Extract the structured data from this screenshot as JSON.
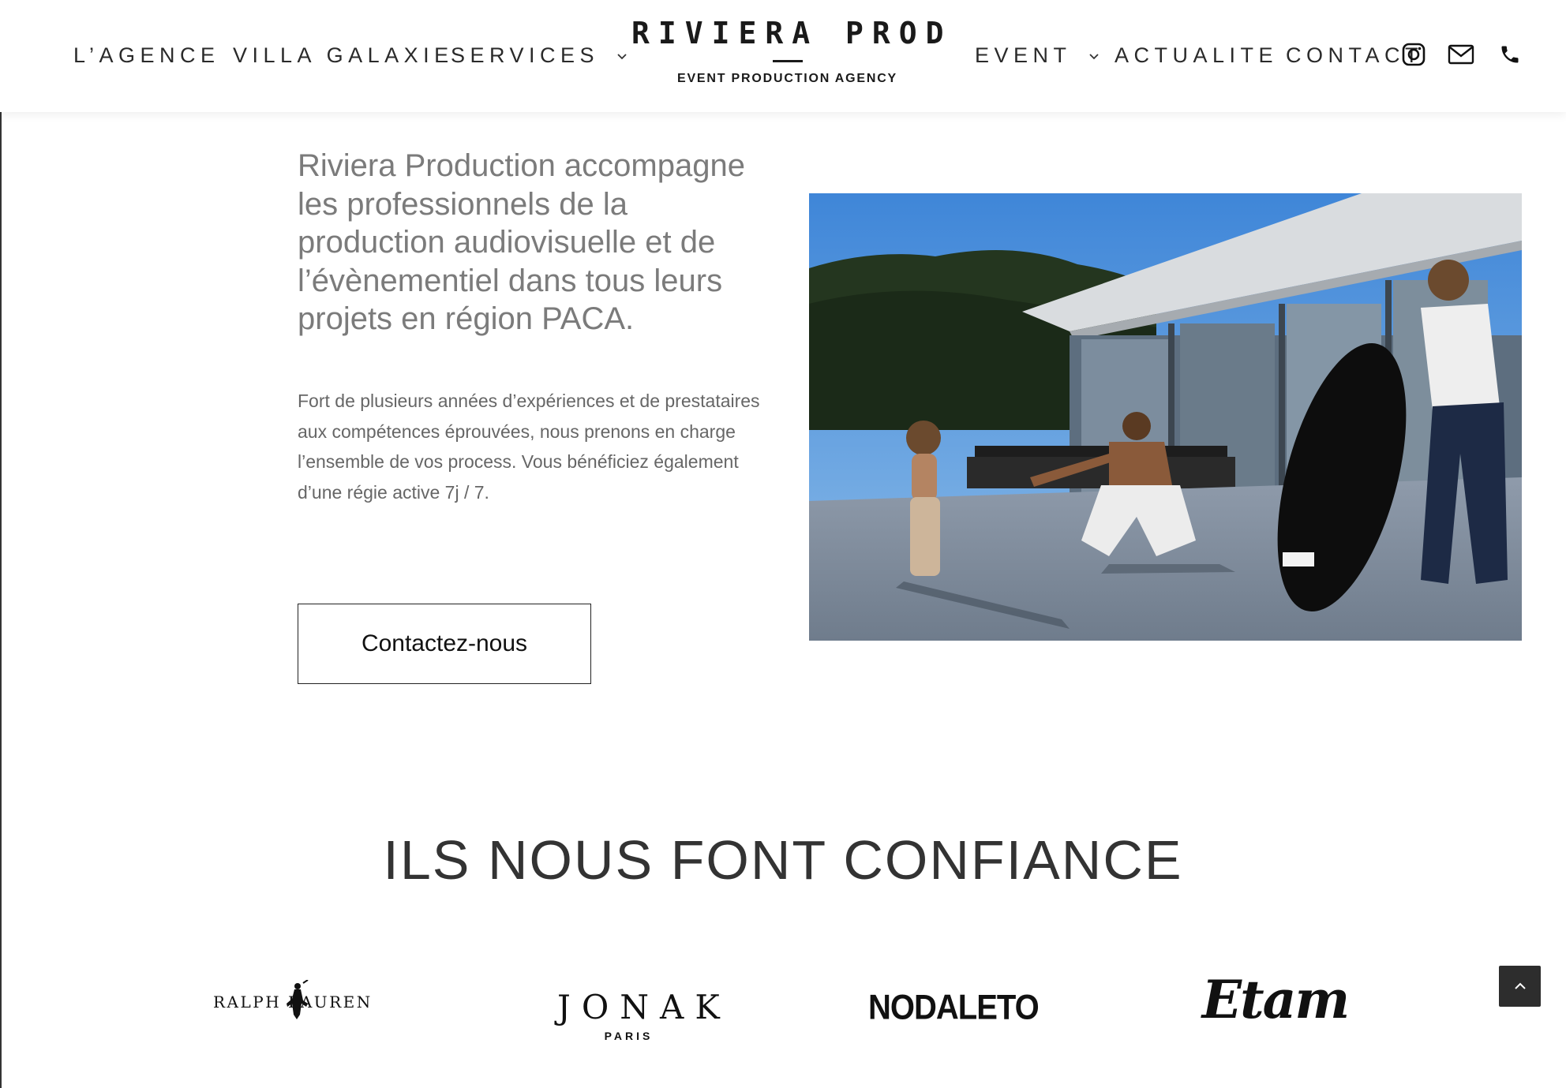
{
  "nav": {
    "left": [
      {
        "label": "L’AGENCE"
      },
      {
        "label": "VILLA GALAXIE"
      },
      {
        "label": "SERVICES"
      }
    ],
    "right": [
      {
        "label": "EVENT"
      },
      {
        "label": "ACTUALITE"
      },
      {
        "label": "CONTACT"
      }
    ],
    "icons": [
      "instagram-icon",
      "mail-icon",
      "phone-icon"
    ]
  },
  "brand": {
    "title": "RIVIERA PROD",
    "subtitle": "EVENT PRODUCTION AGENCY"
  },
  "hero": {
    "lead": "Riviera Production accompagne les professionnels de la production audiovisuelle et de l’évènementiel dans tous leurs projets en région PACA.",
    "body": "Fort de plusieurs années d’expériences et de prestataires aux compétences éprouvées, nous prenons en charge l’ensemble de vos process. Vous bénéficiez également d’une régie active 7j / 7.",
    "cta_label": "Contactez-nous"
  },
  "trust": {
    "title": "ILS NOUS FONT CONFIANCE",
    "logos": [
      {
        "name": "RALPH LAUREN"
      },
      {
        "name": "JONAK",
        "tagline": "PARIS"
      },
      {
        "name": "NODALETO"
      },
      {
        "name": "Etam"
      }
    ]
  },
  "colors": {
    "text_dark": "#111111",
    "text_muted": "#7b7b7b",
    "scroll_button": "#2d2d2d"
  }
}
